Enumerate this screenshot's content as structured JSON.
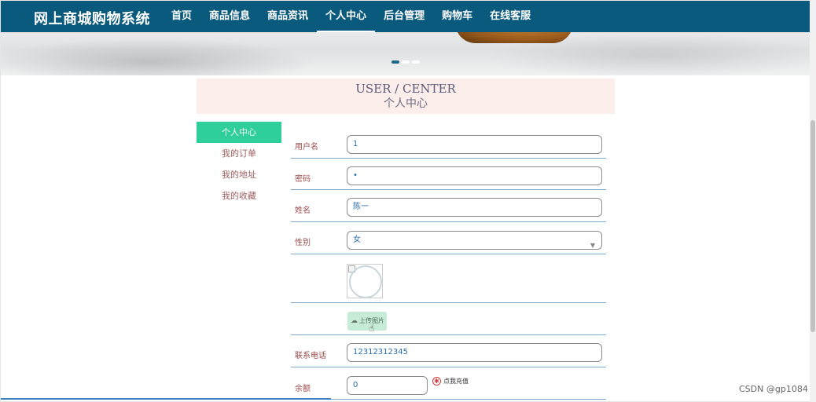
{
  "nav": {
    "brand": "网上商城购物系统",
    "items": [
      {
        "label": "首页"
      },
      {
        "label": "商品信息"
      },
      {
        "label": "商品资讯"
      },
      {
        "label": "个人中心",
        "active": true
      },
      {
        "label": "后台管理"
      },
      {
        "label": "购物车"
      },
      {
        "label": "在线客服"
      }
    ]
  },
  "banner": {
    "slide_count": 3,
    "active_slide": 1
  },
  "header": {
    "title_en": "USER / CENTER",
    "title_cn": "个人中心"
  },
  "sidebar": {
    "items": [
      {
        "label": "个人中心",
        "active": true
      },
      {
        "label": "我的订单"
      },
      {
        "label": "我的地址"
      },
      {
        "label": "我的收藏"
      }
    ]
  },
  "form": {
    "username_label": "用户名",
    "username_value": "1",
    "password_label": "密码",
    "password_value": "•",
    "name_label": "姓名",
    "name_value": "陈一",
    "gender_label": "性别",
    "gender_value": "女",
    "upload_label": "上传图片",
    "phone_label": "联系电话",
    "phone_value": "12312312345",
    "balance_label": "余额",
    "balance_value": "0",
    "recharge_label": "点我充值"
  },
  "watermark": "CSDN @gp1084",
  "colors": {
    "nav_bg": "#0a5a7d",
    "sidebar_active": "#2ecf9a",
    "header_band": "#fcefeb"
  }
}
